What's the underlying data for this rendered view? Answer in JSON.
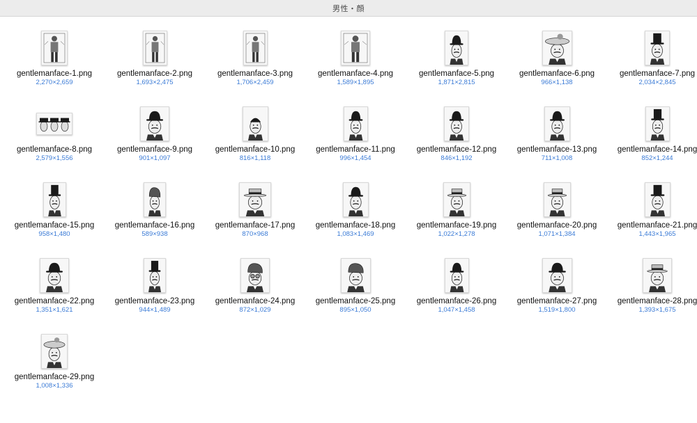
{
  "window": {
    "title": "男性・顔"
  },
  "files": [
    {
      "name": "gentlemanface-1.png",
      "dims": "2,270×2,659",
      "icon": "full-body-engraving-icon"
    },
    {
      "name": "gentlemanface-2.png",
      "dims": "1,693×2,475",
      "icon": "full-body-engraving-icon"
    },
    {
      "name": "gentlemanface-3.png",
      "dims": "1,706×2,459",
      "icon": "full-body-engraving-icon"
    },
    {
      "name": "gentlemanface-4.png",
      "dims": "1,589×1,895",
      "icon": "full-body-engraving-icon"
    },
    {
      "name": "gentlemanface-5.png",
      "dims": "1,871×2,815",
      "icon": "bowler-hat-face-icon"
    },
    {
      "name": "gentlemanface-6.png",
      "dims": "966×1,138",
      "icon": "lady-hat-face-icon"
    },
    {
      "name": "gentlemanface-7.png",
      "dims": "2,034×2,845",
      "icon": "top-hat-face-icon"
    },
    {
      "name": "gentlemanface-8.png",
      "dims": "2,579×1,556",
      "icon": "group-faces-icon"
    },
    {
      "name": "gentlemanface-9.png",
      "dims": "901×1,097",
      "icon": "bowler-hat-face-icon"
    },
    {
      "name": "gentlemanface-10.png",
      "dims": "816×1,118",
      "icon": "face-portrait-icon"
    },
    {
      "name": "gentlemanface-11.png",
      "dims": "996×1,454",
      "icon": "bowler-hat-face-icon"
    },
    {
      "name": "gentlemanface-12.png",
      "dims": "846×1,192",
      "icon": "bowler-hat-face-icon"
    },
    {
      "name": "gentlemanface-13.png",
      "dims": "711×1,008",
      "icon": "bowler-hat-face-icon"
    },
    {
      "name": "gentlemanface-14.png",
      "dims": "852×1,244",
      "icon": "top-hat-face-icon"
    },
    {
      "name": "gentlemanface-15.png",
      "dims": "958×1,480",
      "icon": "top-hat-face-icon"
    },
    {
      "name": "gentlemanface-16.png",
      "dims": "589×938",
      "icon": "cap-face-icon"
    },
    {
      "name": "gentlemanface-17.png",
      "dims": "870×968",
      "icon": "straw-hat-face-icon"
    },
    {
      "name": "gentlemanface-18.png",
      "dims": "1,083×1,469",
      "icon": "bowler-hat-face-icon"
    },
    {
      "name": "gentlemanface-19.png",
      "dims": "1,022×1,278",
      "icon": "straw-hat-face-icon"
    },
    {
      "name": "gentlemanface-20.png",
      "dims": "1,071×1,384",
      "icon": "straw-hat-face-icon"
    },
    {
      "name": "gentlemanface-21.png",
      "dims": "1,443×1,965",
      "icon": "top-hat-face-icon"
    },
    {
      "name": "gentlemanface-22.png",
      "dims": "1,351×1,621",
      "icon": "bowler-hat-face-icon"
    },
    {
      "name": "gentlemanface-23.png",
      "dims": "944×1,489",
      "icon": "top-hat-face-icon"
    },
    {
      "name": "gentlemanface-24.png",
      "dims": "872×1,029",
      "icon": "goggles-cap-face-icon"
    },
    {
      "name": "gentlemanface-25.png",
      "dims": "895×1,050",
      "icon": "flat-cap-face-icon"
    },
    {
      "name": "gentlemanface-26.png",
      "dims": "1,047×1,458",
      "icon": "bowler-hat-face-icon"
    },
    {
      "name": "gentlemanface-27.png",
      "dims": "1,519×1,800",
      "icon": "fedora-face-icon"
    },
    {
      "name": "gentlemanface-28.png",
      "dims": "1,393×1,675",
      "icon": "striped-hat-face-icon"
    },
    {
      "name": "gentlemanface-29.png",
      "dims": "1,008×1,336",
      "icon": "lady-hat-face-icon"
    }
  ]
}
